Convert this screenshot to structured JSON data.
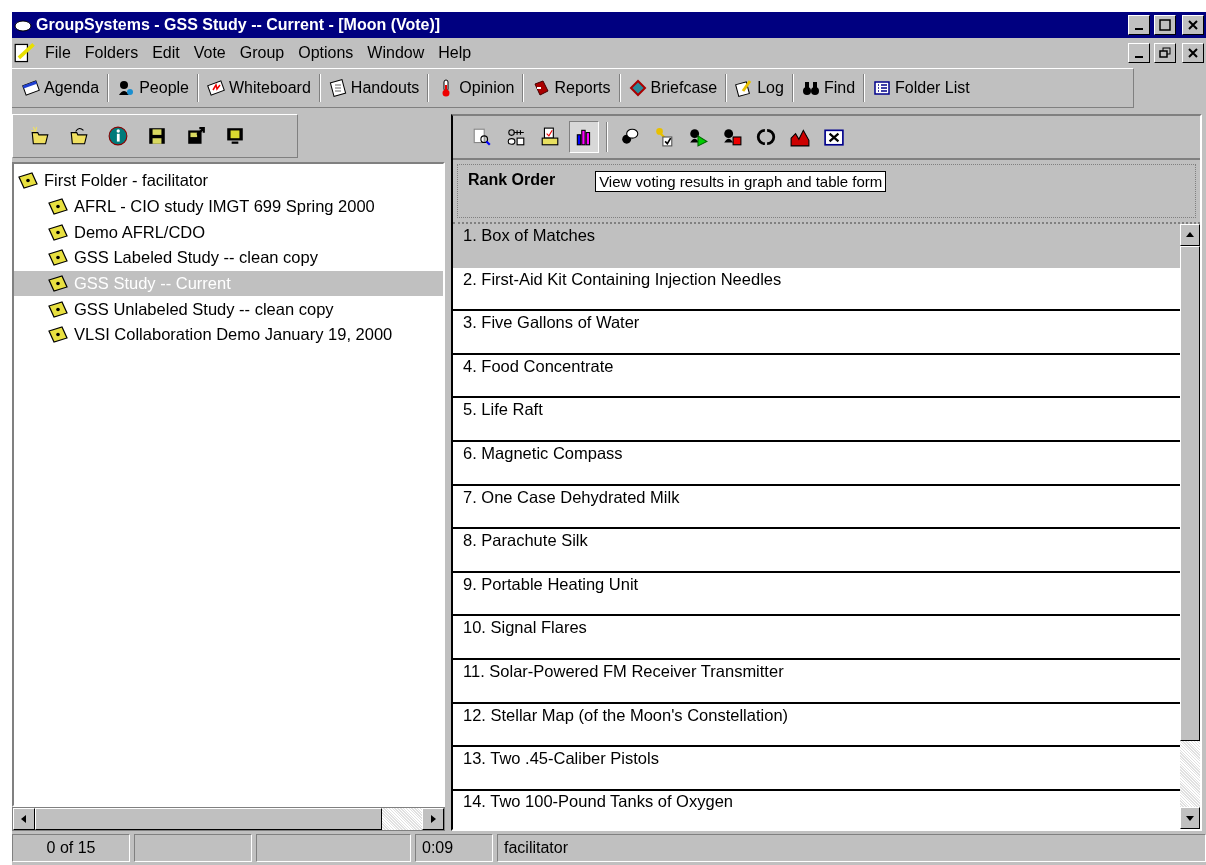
{
  "window": {
    "title": "GroupSystems - GSS Study -- Current - [Moon (Vote)]"
  },
  "menu": [
    "File",
    "Folders",
    "Edit",
    "Vote",
    "Group",
    "Options",
    "Window",
    "Help"
  ],
  "toolbar": [
    {
      "kind": "agenda",
      "label": "Agenda"
    },
    {
      "kind": "people",
      "label": "People"
    },
    {
      "kind": "whiteboard",
      "label": "Whiteboard"
    },
    {
      "kind": "handouts",
      "label": "Handouts"
    },
    {
      "kind": "opinion",
      "label": "Opinion"
    },
    {
      "kind": "reports",
      "label": "Reports"
    },
    {
      "kind": "briefcase",
      "label": "Briefcase"
    },
    {
      "kind": "log",
      "label": "Log"
    },
    {
      "kind": "find",
      "label": "Find"
    },
    {
      "kind": "folderlist",
      "label": "Folder List"
    }
  ],
  "folder_tools": [
    {
      "kind": "new-folder"
    },
    {
      "kind": "open-folder"
    },
    {
      "kind": "info"
    },
    {
      "kind": "save"
    },
    {
      "kind": "save-export"
    },
    {
      "kind": "monitor"
    }
  ],
  "folder_tree": [
    {
      "label": "First Folder - facilitator",
      "selected": false,
      "children": [
        {
          "label": "AFRL - CIO study IMGT 699 Spring 2000",
          "selected": false
        },
        {
          "label": "Demo AFRL/CDO",
          "selected": false
        },
        {
          "label": "GSS Labeled Study -- clean copy",
          "selected": false
        },
        {
          "label": "GSS Study -- Current",
          "selected": true
        },
        {
          "label": "GSS Unlabeled Study -- clean copy",
          "selected": false
        },
        {
          "label": "VLSI Collaboration Demo January 19, 2000",
          "selected": false
        }
      ]
    }
  ],
  "vote_tools": [
    {
      "kind": "preview",
      "selected": false
    },
    {
      "kind": "ballot",
      "selected": false
    },
    {
      "kind": "print",
      "selected": false
    },
    {
      "kind": "chart",
      "selected": true
    },
    {
      "kind": "comments",
      "selected": false
    },
    {
      "kind": "key-check",
      "selected": false
    },
    {
      "kind": "start",
      "selected": false
    },
    {
      "kind": "stop",
      "selected": false
    },
    {
      "kind": "refresh",
      "selected": false
    },
    {
      "kind": "area-chart",
      "selected": false
    },
    {
      "kind": "close",
      "selected": false
    }
  ],
  "results": {
    "heading": "Rank Order",
    "tooltip": "View voting results in graph and table form",
    "rows": [
      {
        "text": "1. Box of Matches",
        "selected": true
      },
      {
        "text": "2. First-Aid Kit Containing Injection Needles",
        "selected": false
      },
      {
        "text": "3. Five Gallons of Water",
        "selected": false
      },
      {
        "text": "4. Food Concentrate",
        "selected": false
      },
      {
        "text": "5. Life Raft",
        "selected": false
      },
      {
        "text": "6. Magnetic Compass",
        "selected": false
      },
      {
        "text": "7. One Case Dehydrated Milk",
        "selected": false
      },
      {
        "text": "8. Parachute Silk",
        "selected": false
      },
      {
        "text": "9. Portable Heating Unit",
        "selected": false
      },
      {
        "text": "10. Signal Flares",
        "selected": false
      },
      {
        "text": "11. Solar-Powered FM Receiver Transmitter",
        "selected": false
      },
      {
        "text": "12. Stellar Map (of the Moon's Constellation)",
        "selected": false
      },
      {
        "text": "13. Two .45-Caliber Pistols",
        "selected": false
      },
      {
        "text": "14. Two 100-Pound Tanks of Oxygen",
        "selected": false
      }
    ]
  },
  "status_bar": [
    "0 of 15",
    "0:09",
    "facilitator"
  ]
}
